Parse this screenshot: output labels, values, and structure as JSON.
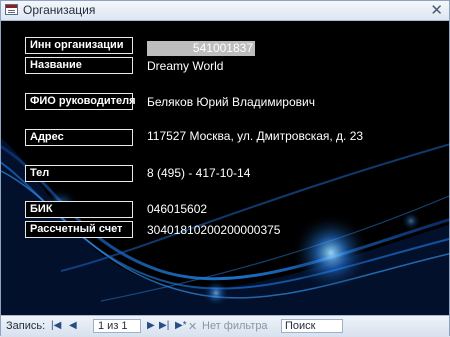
{
  "window": {
    "title": "Организация"
  },
  "form": {
    "fields": [
      {
        "label": "Инн организации",
        "value": "541001837"
      },
      {
        "label": "Название",
        "value": "Dreamy World"
      },
      {
        "label": "ФИО руководителя",
        "value": "Беляков Юрий Владимирович"
      },
      {
        "label": "Адрес",
        "value": "117527 Москва, ул. Дмитровская, д. 23"
      },
      {
        "label": "Тел",
        "value": "8 (495) - 417-10-14"
      },
      {
        "label": "БИК",
        "value": "046015602"
      },
      {
        "label": "Рассчетный счет",
        "value": "30401810200200000375"
      }
    ]
  },
  "navbar": {
    "record_label": "Запись:",
    "record_position": "1 из 1",
    "filter_label": "Нет фильтра",
    "search_placeholder": "Поиск"
  },
  "colors": {
    "background": "#000000",
    "wave_accent": "#1e7fe0",
    "titlebar": "#e7eef7"
  }
}
